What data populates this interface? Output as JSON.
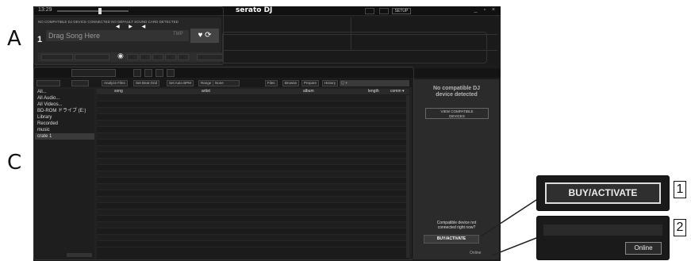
{
  "callouts": {
    "a": "A",
    "c": "C",
    "one": "1",
    "two": "2"
  },
  "topbar": {
    "time": "13:29",
    "logo": "serato  DJ",
    "setup": "SETUP",
    "window_controls": "_ ▫ ×"
  },
  "deck": {
    "notice": "NO COMPATIBLE DJ DEVICE CONNECTED   NO DEFAULT SOUND CARD DETECTED",
    "number": "1",
    "song": "Drag Song Here",
    "tmp": "TMP",
    "load_icons": "♥ ⟳",
    "transport": "◀ ▶ ◀"
  },
  "library": {
    "toolbar": {
      "analyze": "Analyze Files",
      "set_beatgrid": "Set Beat Grid",
      "set_auto_bpm": "Set Auto BPM",
      "range": "Range",
      "range_value": "None",
      "files": "Files",
      "browse": "Browse",
      "prepare": "Prepare",
      "history": "History",
      "search_placeholder": "Q ▾"
    },
    "sidebar": [
      "All...",
      "All Audio...",
      "All Videos...",
      "BD-ROM ドライブ (E:)",
      "Library",
      "Recorded",
      "music",
      "crate 1"
    ],
    "columns": {
      "song": "song",
      "artist": "artist",
      "album": "album",
      "length": "length",
      "comment": "comm ▾"
    }
  },
  "right_panel": {
    "title_line1": "No compatible DJ",
    "title_line2": "device detected",
    "view_devices_line1": "VIEW COMPATIBLE",
    "view_devices_line2": "DEVICES",
    "question_line1": "Compatible device not",
    "question_line2": "connected right now?",
    "buy_activate": "BUY/ACTIVATE",
    "online": "Online"
  },
  "zoom": {
    "buy_activate": "BUY/ACTIVATE",
    "online": "Online"
  }
}
